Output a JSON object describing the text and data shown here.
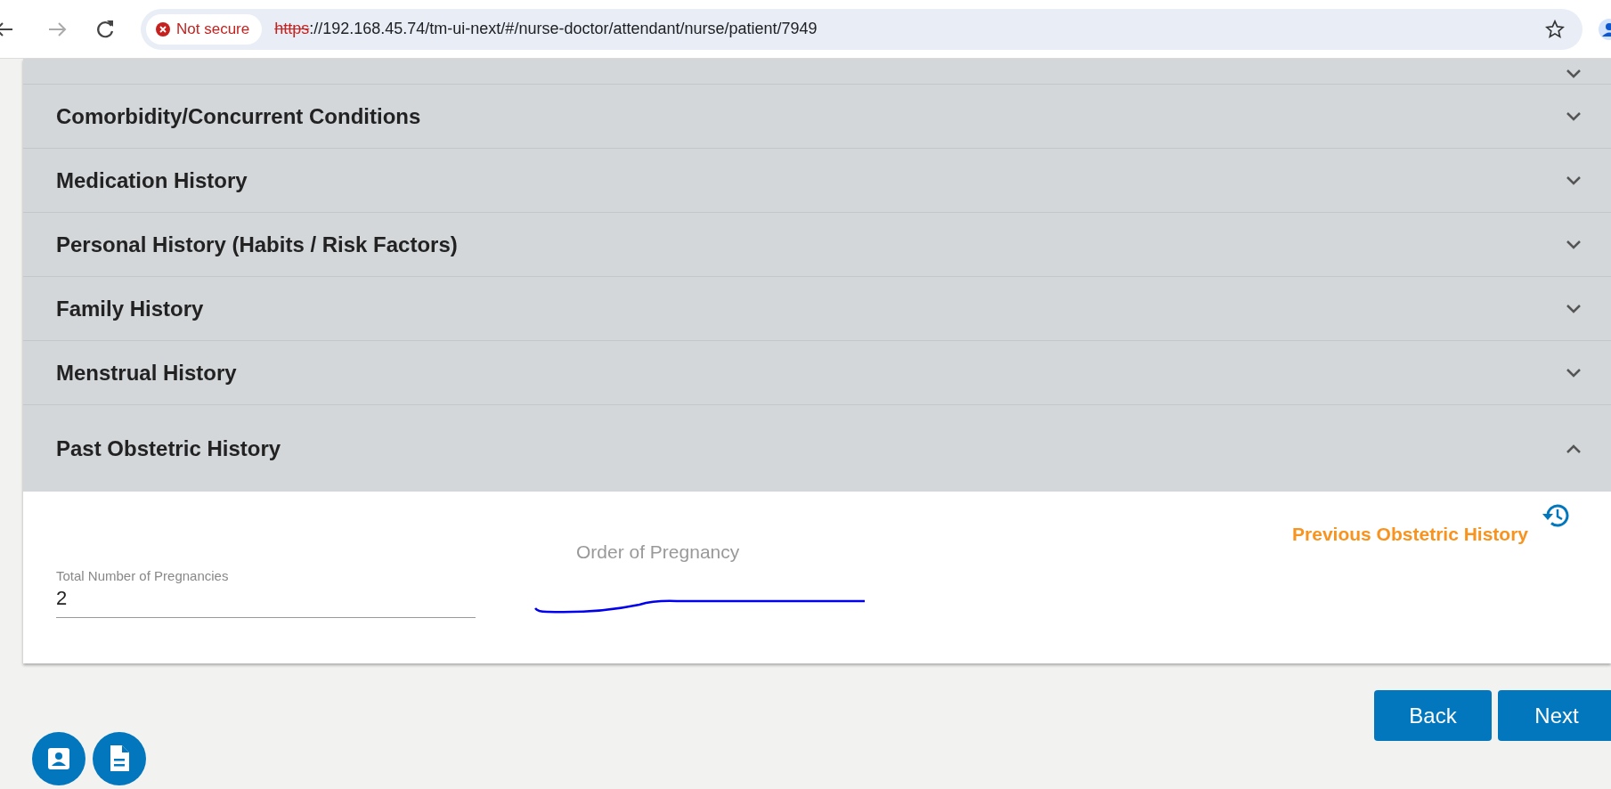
{
  "browser": {
    "security_label": "Not secure",
    "url_scheme": "https",
    "url_rest": "://192.168.45.74/tm-ui-next/#/nurse-doctor/attendant/nurse/patient/7949"
  },
  "sections": [
    {
      "expanded": false
    },
    {
      "title": "Comorbidity/Concurrent Conditions",
      "expanded": false
    },
    {
      "title": "Medication History",
      "expanded": false
    },
    {
      "title": "Personal History (Habits / Risk Factors)",
      "expanded": false
    },
    {
      "title": "Family History",
      "expanded": false
    },
    {
      "title": "Menstrual History",
      "expanded": false
    },
    {
      "title": "Past Obstetric History",
      "expanded": true
    }
  ],
  "obstetric": {
    "history_link": "Previous Obstetric History",
    "field": {
      "label": "Total Number of Pregnancies",
      "value": "2"
    },
    "order_label": "Order of Pregnancy"
  },
  "buttons": [
    {
      "label": "Back"
    },
    {
      "label": "Next"
    }
  ],
  "fabs": [
    {
      "kind": "contact"
    },
    {
      "kind": "document"
    }
  ]
}
